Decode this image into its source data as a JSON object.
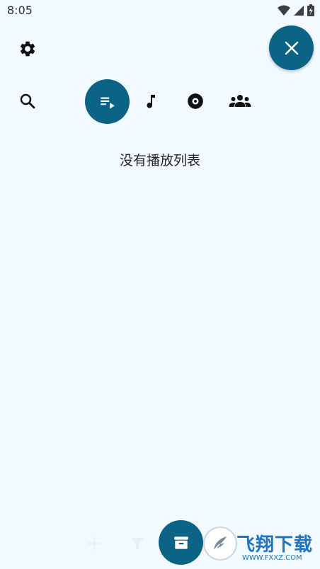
{
  "status_bar": {
    "time": "8:05",
    "icons": [
      "wifi-icon",
      "signal-icon",
      "battery-icon"
    ]
  },
  "header": {
    "settings_icon": "gear-icon",
    "close_icon": "close-icon"
  },
  "tabs": [
    {
      "name": "search",
      "icon": "search-icon",
      "active": false
    },
    {
      "name": "playlists",
      "icon": "playlist-play-icon",
      "active": true
    },
    {
      "name": "songs",
      "icon": "music-note-icon",
      "active": false
    },
    {
      "name": "albums",
      "icon": "album-icon",
      "active": false
    },
    {
      "name": "artists",
      "icon": "group-icon",
      "active": false
    }
  ],
  "main": {
    "empty_message": "没有播放列表"
  },
  "bottom_bar": {
    "add_icon": "plus-icon",
    "filter_icon": "filter-icon",
    "archive_icon": "archive-icon"
  },
  "watermark": {
    "text": "飞翔下载",
    "url": "WWW.FXXZ.COM"
  },
  "colors": {
    "background": "#f3faff",
    "accent": "#0b6385",
    "watermark": "#1d73c4"
  }
}
